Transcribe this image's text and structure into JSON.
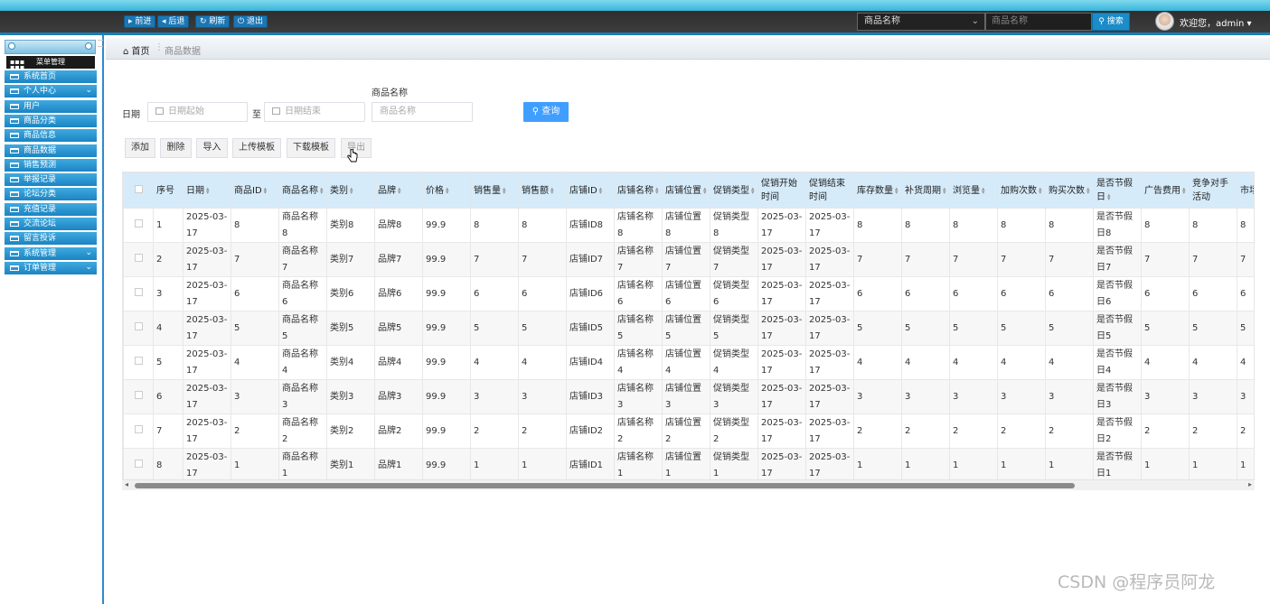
{
  "topbar": {
    "nav": [
      "前进",
      "后退",
      "刷新",
      "退出"
    ],
    "search_select": "商品名称",
    "search_placeholder": "商品名称",
    "search_button": "搜索",
    "welcome": "欢迎您，admin"
  },
  "sidebar": {
    "title": "菜单管理",
    "items": [
      {
        "label": "系统首页",
        "expandable": false
      },
      {
        "label": "个人中心",
        "expandable": true
      },
      {
        "label": "用户",
        "expandable": false
      },
      {
        "label": "商品分类",
        "expandable": false
      },
      {
        "label": "商品信息",
        "expandable": false
      },
      {
        "label": "商品数据",
        "expandable": false
      },
      {
        "label": "销售预测",
        "expandable": false
      },
      {
        "label": "举报记录",
        "expandable": false
      },
      {
        "label": "论坛分类",
        "expandable": false
      },
      {
        "label": "充值记录",
        "expandable": false
      },
      {
        "label": "交流论坛",
        "expandable": false
      },
      {
        "label": "留言投诉",
        "expandable": false
      },
      {
        "label": "系统管理",
        "expandable": true
      },
      {
        "label": "订单管理",
        "expandable": true
      }
    ]
  },
  "breadcrumb": {
    "home": "首页",
    "current": "商品数据"
  },
  "filters": {
    "date_label": "日期",
    "date_start_placeholder": "日期起始",
    "to_label": "至",
    "date_end_placeholder": "日期结束",
    "name_label": "商品名称",
    "name_placeholder": "商品名称",
    "query_button": "查询"
  },
  "actions": [
    "添加",
    "删除",
    "导入",
    "上传模板",
    "下载模板",
    "导出"
  ],
  "table": {
    "columns": [
      {
        "label": "",
        "sortable": false
      },
      {
        "label": "序号",
        "sortable": false
      },
      {
        "label": "日期",
        "sortable": true
      },
      {
        "label": "商品ID",
        "sortable": true
      },
      {
        "label": "商品名称",
        "sortable": true
      },
      {
        "label": "类别",
        "sortable": true
      },
      {
        "label": "品牌",
        "sortable": true
      },
      {
        "label": "价格",
        "sortable": true
      },
      {
        "label": "销售量",
        "sortable": true
      },
      {
        "label": "销售额",
        "sortable": true
      },
      {
        "label": "店铺ID",
        "sortable": true
      },
      {
        "label": "店铺名称",
        "sortable": true
      },
      {
        "label": "店铺位置",
        "sortable": true
      },
      {
        "label": "促销类型",
        "sortable": true
      },
      {
        "label": "促销开始时间",
        "sortable": false
      },
      {
        "label": "促销结束时间",
        "sortable": false
      },
      {
        "label": "库存数量",
        "sortable": true
      },
      {
        "label": "补货周期",
        "sortable": true
      },
      {
        "label": "浏览量",
        "sortable": true
      },
      {
        "label": "加购次数",
        "sortable": true
      },
      {
        "label": "购买次数",
        "sortable": true
      },
      {
        "label": "是否节假日",
        "sortable": true
      },
      {
        "label": "广告费用",
        "sortable": true
      },
      {
        "label": "竞争对手活动",
        "sortable": false
      },
      {
        "label": "市场数",
        "sortable": false
      }
    ],
    "rows": [
      [
        "1",
        "2025-03-17",
        "8",
        "商品名称8",
        "类别8",
        "品牌8",
        "99.9",
        "8",
        "8",
        "店铺ID8",
        "店铺名称8",
        "店铺位置8",
        "促销类型8",
        "2025-03-17",
        "2025-03-17",
        "8",
        "8",
        "8",
        "8",
        "8",
        "是否节假日8",
        "8",
        "8",
        "8"
      ],
      [
        "2",
        "2025-03-17",
        "7",
        "商品名称7",
        "类别7",
        "品牌7",
        "99.9",
        "7",
        "7",
        "店铺ID7",
        "店铺名称7",
        "店铺位置7",
        "促销类型7",
        "2025-03-17",
        "2025-03-17",
        "7",
        "7",
        "7",
        "7",
        "7",
        "是否节假日7",
        "7",
        "7",
        "7"
      ],
      [
        "3",
        "2025-03-17",
        "6",
        "商品名称6",
        "类别6",
        "品牌6",
        "99.9",
        "6",
        "6",
        "店铺ID6",
        "店铺名称6",
        "店铺位置6",
        "促销类型6",
        "2025-03-17",
        "2025-03-17",
        "6",
        "6",
        "6",
        "6",
        "6",
        "是否节假日6",
        "6",
        "6",
        "6"
      ],
      [
        "4",
        "2025-03-17",
        "5",
        "商品名称5",
        "类别5",
        "品牌5",
        "99.9",
        "5",
        "5",
        "店铺ID5",
        "店铺名称5",
        "店铺位置5",
        "促销类型5",
        "2025-03-17",
        "2025-03-17",
        "5",
        "5",
        "5",
        "5",
        "5",
        "是否节假日5",
        "5",
        "5",
        "5"
      ],
      [
        "5",
        "2025-03-17",
        "4",
        "商品名称4",
        "类别4",
        "品牌4",
        "99.9",
        "4",
        "4",
        "店铺ID4",
        "店铺名称4",
        "店铺位置4",
        "促销类型4",
        "2025-03-17",
        "2025-03-17",
        "4",
        "4",
        "4",
        "4",
        "4",
        "是否节假日4",
        "4",
        "4",
        "4"
      ],
      [
        "6",
        "2025-03-17",
        "3",
        "商品名称3",
        "类别3",
        "品牌3",
        "99.9",
        "3",
        "3",
        "店铺ID3",
        "店铺名称3",
        "店铺位置3",
        "促销类型3",
        "2025-03-17",
        "2025-03-17",
        "3",
        "3",
        "3",
        "3",
        "3",
        "是否节假日3",
        "3",
        "3",
        "3"
      ],
      [
        "7",
        "2025-03-17",
        "2",
        "商品名称2",
        "类别2",
        "品牌2",
        "99.9",
        "2",
        "2",
        "店铺ID2",
        "店铺名称2",
        "店铺位置2",
        "促销类型2",
        "2025-03-17",
        "2025-03-17",
        "2",
        "2",
        "2",
        "2",
        "2",
        "是否节假日2",
        "2",
        "2",
        "2"
      ],
      [
        "8",
        "2025-03-17",
        "1",
        "商品名称1",
        "类别1",
        "品牌1",
        "99.9",
        "1",
        "1",
        "店铺ID1",
        "店铺名称1",
        "店铺位置1",
        "促销类型1",
        "2025-03-17",
        "2025-03-17",
        "1",
        "1",
        "1",
        "1",
        "1",
        "是否节假日1",
        "1",
        "1",
        "1"
      ]
    ]
  },
  "watermark": "CSDN @程序员阿龙"
}
